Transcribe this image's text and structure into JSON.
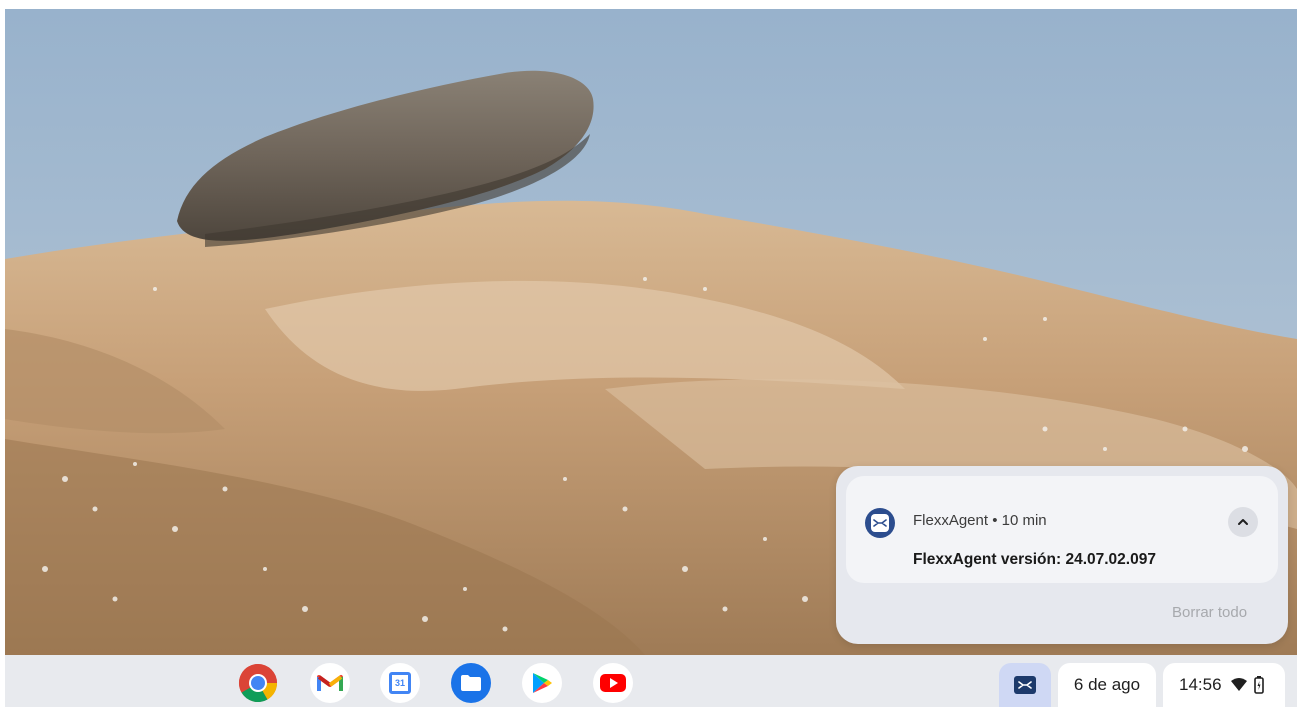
{
  "wallpaper": {
    "description_icon": "landscape-wallpaper"
  },
  "shelf": {
    "apps": [
      {
        "name": "Chrome",
        "icon": "chrome-icon"
      },
      {
        "name": "Gmail",
        "icon": "gmail-icon"
      },
      {
        "name": "Calendar",
        "icon": "calendar-icon",
        "label": "31"
      },
      {
        "name": "Files",
        "icon": "files-icon"
      },
      {
        "name": "Play Store",
        "icon": "play-store-icon"
      },
      {
        "name": "YouTube",
        "icon": "youtube-icon"
      }
    ]
  },
  "tray": {
    "flexx_icon": "flexxagent-tray-icon",
    "date": "6 de ago",
    "time": "14:56"
  },
  "notification": {
    "app_name": "FlexxAgent",
    "separator": "•",
    "age": "10 min",
    "header": "FlexxAgent • 10 min",
    "message": "FlexxAgent versión: 24.07.02.097",
    "clear_all": "Borrar todo"
  },
  "colors": {
    "shelf_bg": "#e8eaee",
    "tray_highlight": "#cfd8f4",
    "notification_bg": "#e6e8ee",
    "card_bg": "#f3f4f7",
    "app_icon_bg": "#2c4d8e"
  }
}
